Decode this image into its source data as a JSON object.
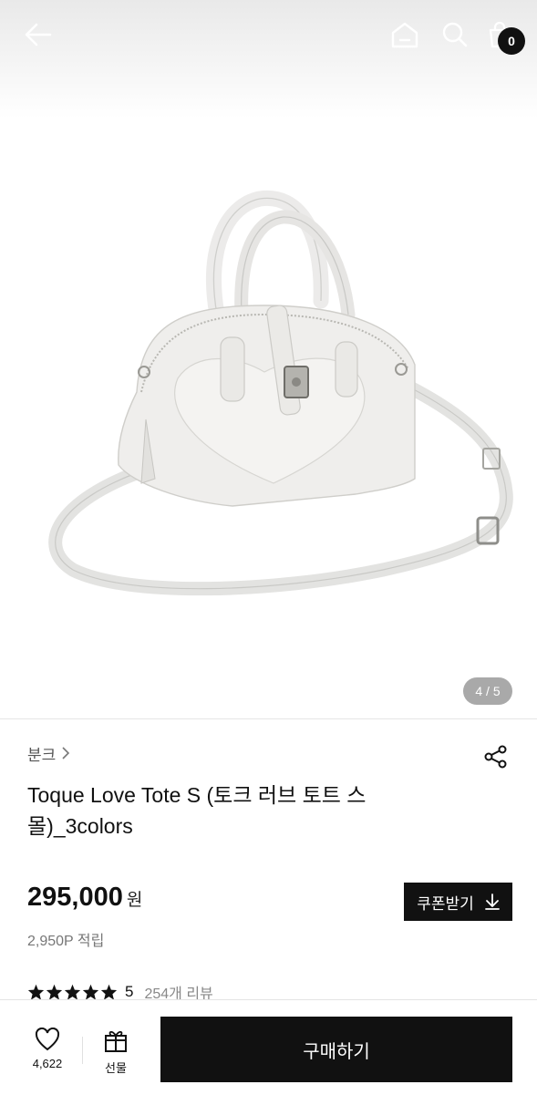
{
  "header": {
    "back_icon": "arrow-left-icon",
    "home_icon": "home-icon",
    "search_icon": "search-icon",
    "cart_icon": "shopping-bag-icon",
    "cart_count": "0"
  },
  "gallery": {
    "counter": "4 / 5",
    "current": 4,
    "total": 5
  },
  "product": {
    "brand": "분크",
    "title": "Toque Love Tote S (토크 러브 토트 스몰)_3colors",
    "price": "295,000",
    "currency": "원",
    "points": "2,950P 적립",
    "rating": 5,
    "rating_label": "5",
    "reviews": "254개 리뷰"
  },
  "coupon": {
    "label": "쿠폰받기",
    "icon": "download-icon"
  },
  "bottom_bar": {
    "like_count": "4,622",
    "gift_label": "선물",
    "buy_label": "구매하기"
  },
  "colors": {
    "accent": "#111111",
    "badge": "#111111",
    "counter_bg": "#a9a9a9"
  }
}
